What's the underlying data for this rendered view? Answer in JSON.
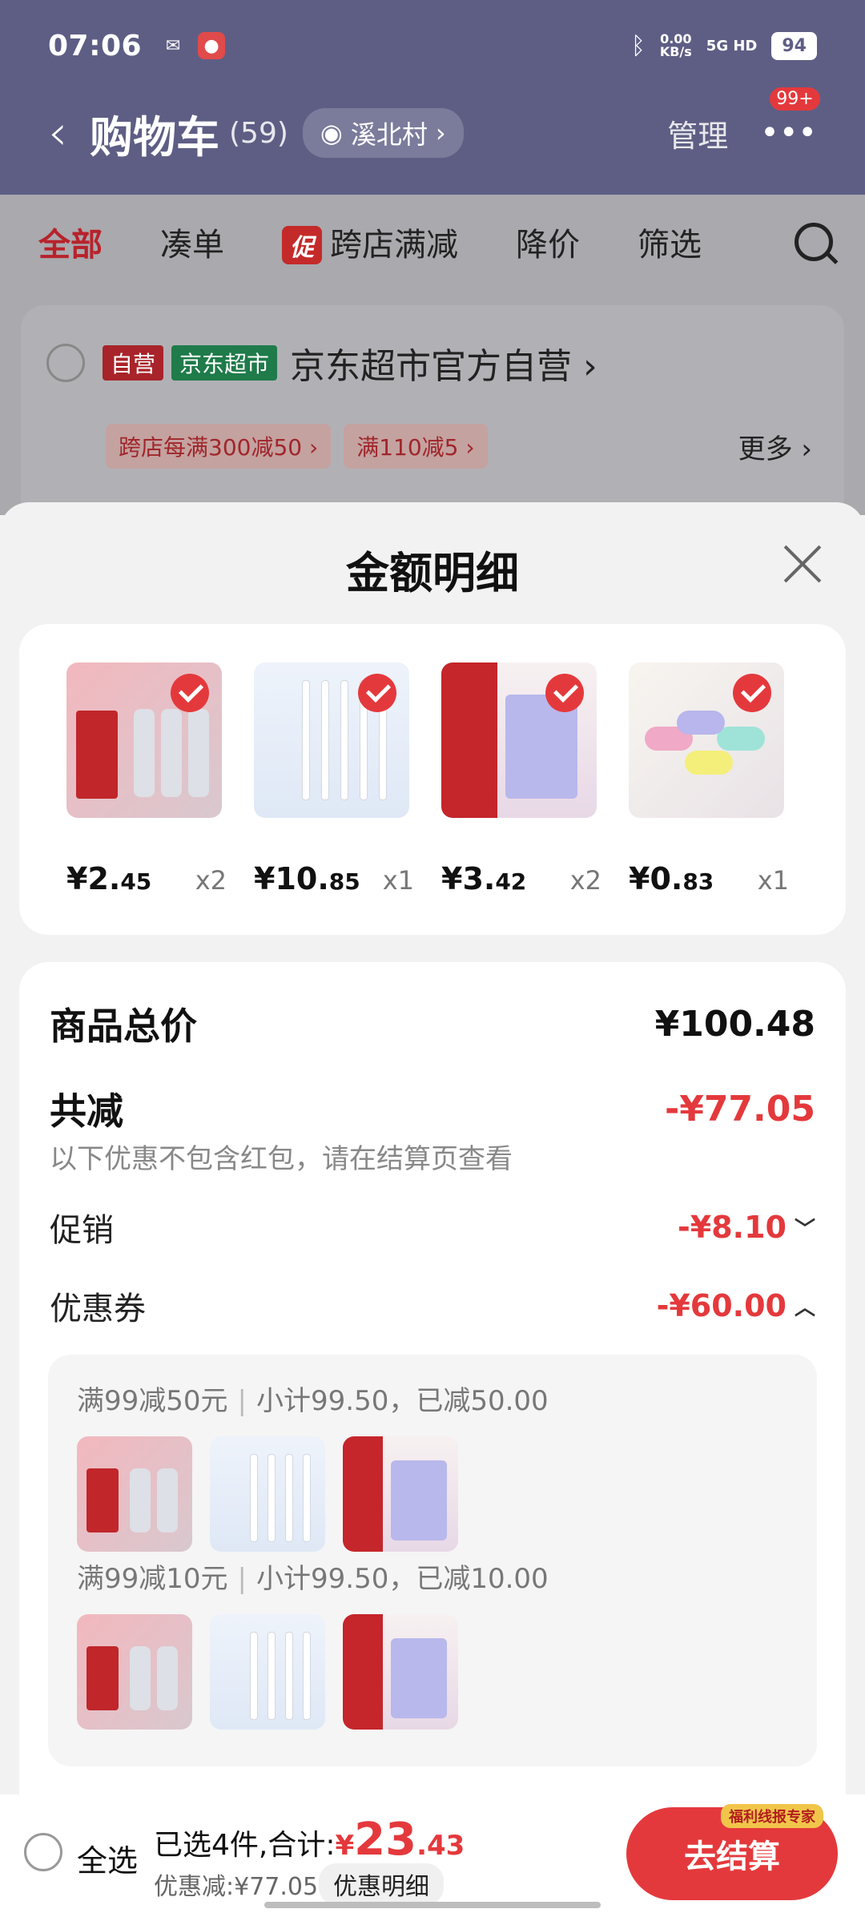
{
  "status": {
    "time": "07:06",
    "net_speed": "0.00",
    "net_unit": "KB/s",
    "signal": "5G HD",
    "battery": "94"
  },
  "header": {
    "title": "购物车",
    "count": "(59)",
    "location": "溪北村",
    "manage": "管理",
    "badge": "99+"
  },
  "tabs": [
    {
      "label": "全部",
      "active": true
    },
    {
      "label": "凑单"
    },
    {
      "label": "跨店满减",
      "promo": "促"
    },
    {
      "label": "降价"
    },
    {
      "label": "筛选"
    }
  ],
  "shop": {
    "tag_self": "自营",
    "tag_jd": "京东超市",
    "name": "京东超市官方自营",
    "coupons": [
      "跨店每满300减50",
      "满110减5"
    ],
    "more": "更多"
  },
  "sheet": {
    "title": "金额明细",
    "products": [
      {
        "price_int": "¥2.",
        "price_dec": "45",
        "qty": "x2"
      },
      {
        "price_int": "¥10.",
        "price_dec": "85",
        "qty": "x1"
      },
      {
        "price_int": "¥3.",
        "price_dec": "42",
        "qty": "x2"
      },
      {
        "price_int": "¥0.",
        "price_dec": "83",
        "qty": "x1"
      }
    ],
    "summary": {
      "total_label": "商品总价",
      "total_value": "¥100.48",
      "reduce_label": "共减",
      "reduce_value": "-¥77.05",
      "reduce_note": "以下优惠不包含红包，请在结算页查看",
      "promo_label": "促销",
      "promo_value": "-¥8.10",
      "coupon_label": "优惠券",
      "coupon_value": "-¥60.00"
    },
    "coupon_groups": [
      {
        "rule": "满99减50元",
        "detail": "小计99.50，已减50.00"
      },
      {
        "rule": "满99减10元",
        "detail": "小计99.50，已减10.00"
      }
    ]
  },
  "bottom": {
    "select_all": "全选",
    "selected_text": "已选4件,合计:",
    "currency": "¥",
    "amount_int": "23",
    "amount_dec": ".43",
    "saved": "优惠减:¥77.05",
    "detail_button": "优惠明细",
    "checkout": "去结算",
    "welfare": "福利线报专家"
  },
  "colors": {
    "header_bg": "#5e5e85",
    "accent": "#e4393c"
  }
}
